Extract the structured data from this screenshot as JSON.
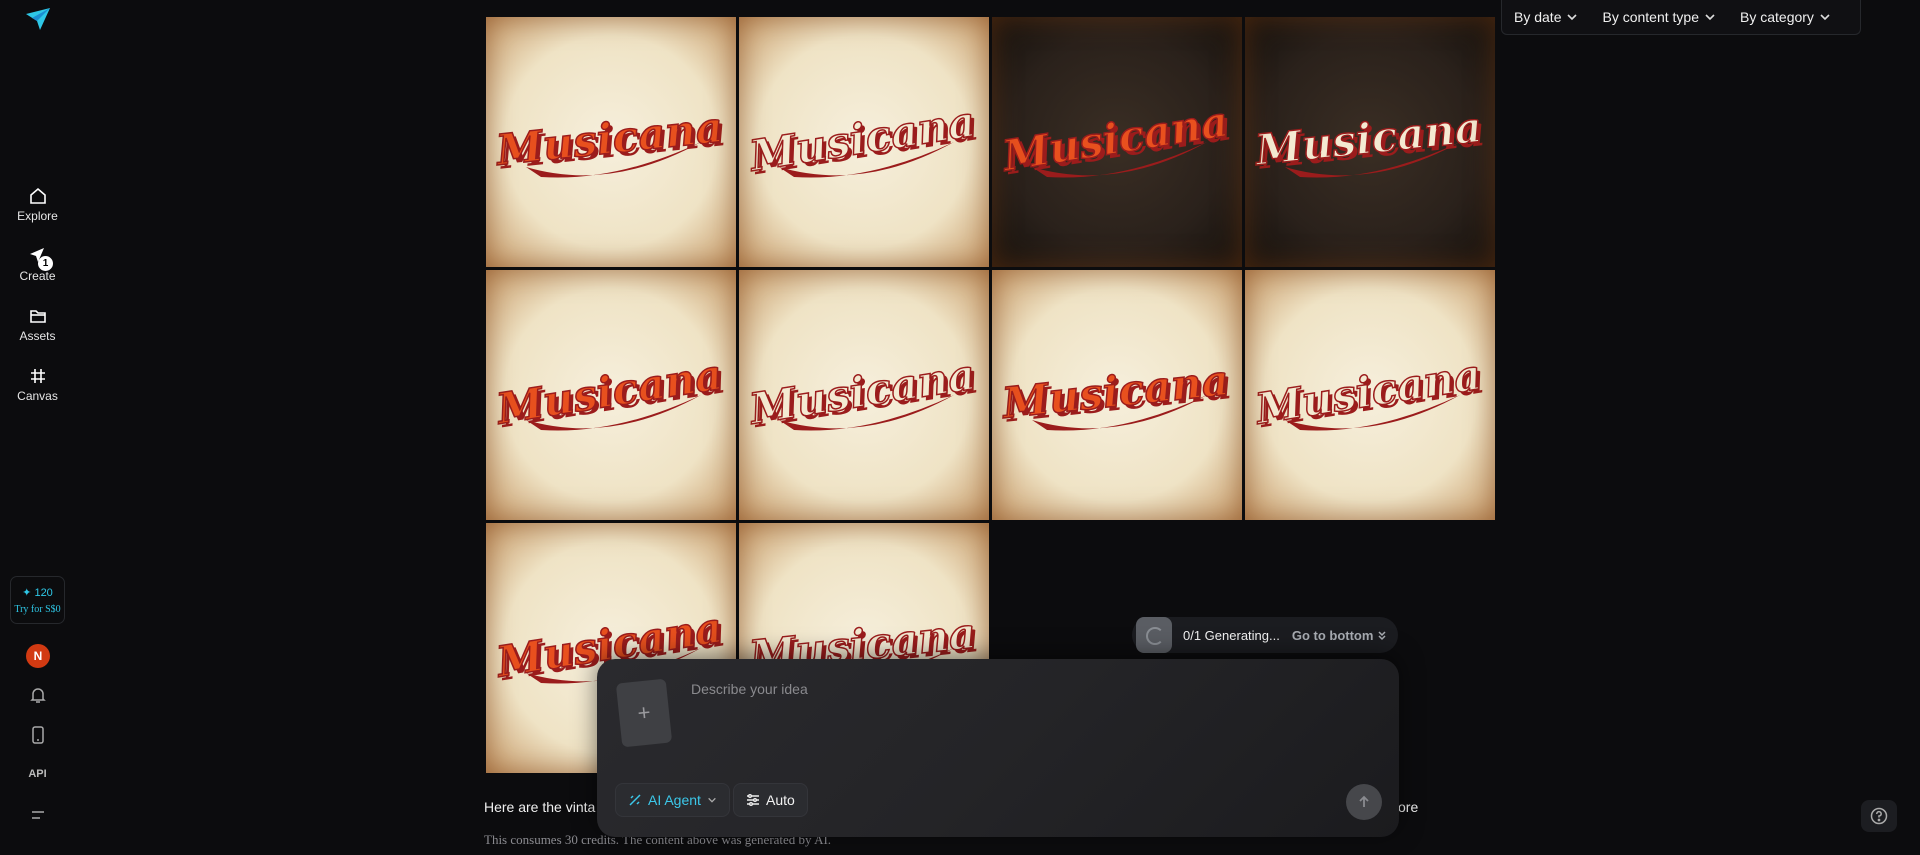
{
  "sidebar": {
    "items": [
      {
        "label": "Explore",
        "icon": "home-icon"
      },
      {
        "label": "Create",
        "icon": "create-icon",
        "badge": "1"
      },
      {
        "label": "Assets",
        "icon": "folder-icon"
      },
      {
        "label": "Canvas",
        "icon": "canvas-icon"
      }
    ],
    "credits": {
      "amount": "✦ 120",
      "cta": "Try for S$0"
    },
    "avatar_initial": "N",
    "api_label": "API"
  },
  "filters": [
    {
      "label": "By date"
    },
    {
      "label": "By content type"
    },
    {
      "label": "By category"
    }
  ],
  "gallery": {
    "images": [
      {
        "word": "Musicana",
        "bg": "light"
      },
      {
        "word": "Musicana",
        "bg": "light"
      },
      {
        "word": "Musicana",
        "bg": "dark"
      },
      {
        "word": "Musicana",
        "bg": "dark"
      },
      {
        "word": "Musicana",
        "bg": "light"
      },
      {
        "word": "Musicana",
        "bg": "light"
      },
      {
        "word": "Musicana",
        "bg": "light"
      },
      {
        "word": "Musicana",
        "bg": "light"
      },
      {
        "word": "Musicana",
        "bg": "light"
      },
      {
        "word": "Musicana",
        "bg": "light"
      }
    ]
  },
  "message": {
    "caption_start": "Here are the vinta",
    "caption_end": "ore",
    "credits_note": "This consumes 30 credits. The content above was generated by AI."
  },
  "generating": {
    "status": "0/1 Generating...",
    "link": "Go to bottom"
  },
  "composer": {
    "placeholder": "Describe your idea",
    "agent_label": "AI Agent",
    "mode_label": "Auto",
    "add_symbol": "+"
  },
  "colors": {
    "accent": "#2ec7e6",
    "background": "#0c0c0e",
    "logo_orange": "#e8501e",
    "logo_red": "#9b1c1c",
    "logo_cream": "#f4ead2"
  }
}
